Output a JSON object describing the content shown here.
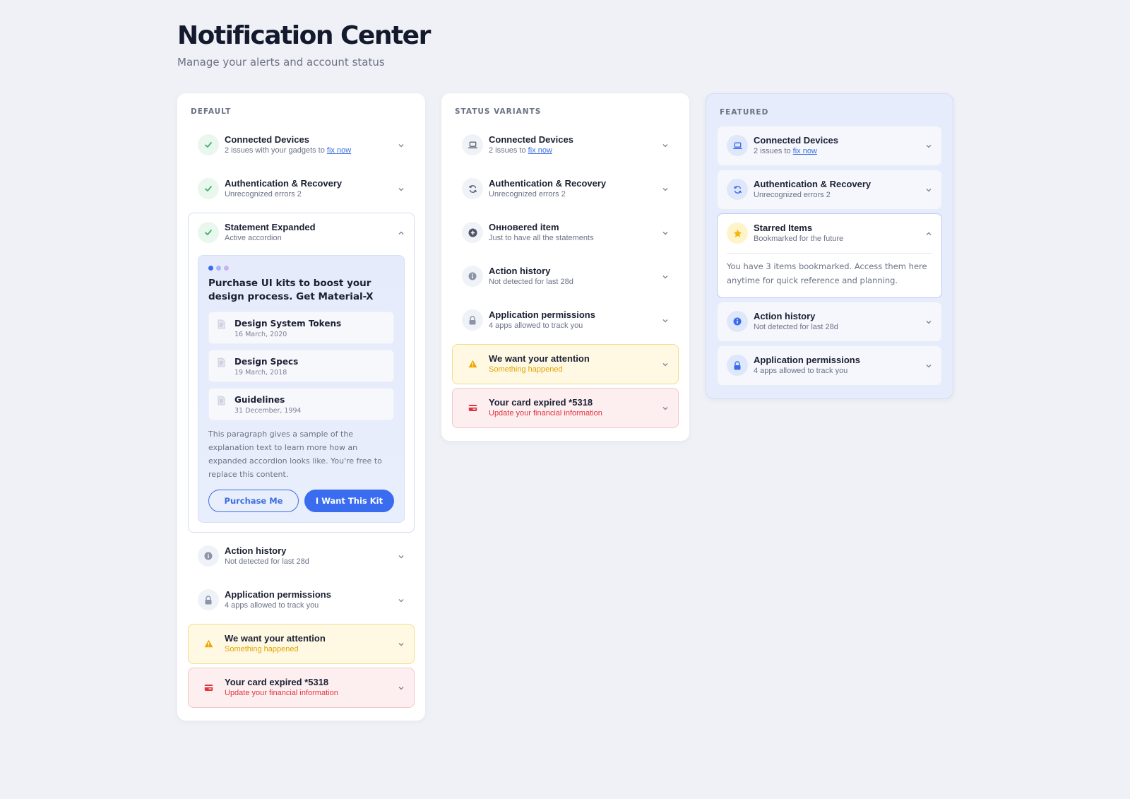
{
  "header": {
    "title": "Notification Center",
    "subtitle": "Manage your alerts and account status"
  },
  "panels": {
    "default": {
      "label": "DEFAULT",
      "items": [
        {
          "title": "Connected Devices",
          "sub_prefix": "2 issues with your gadgets to ",
          "link": "fix now",
          "icon": "check-icon"
        },
        {
          "title": "Authentication & Recovery",
          "sub": "Unrecognized errors 2",
          "icon": "check-icon"
        },
        {
          "title": "Statement Expanded",
          "sub": "Active accordion",
          "icon": "check-icon"
        },
        {
          "title": "Action history",
          "sub": "Not detected for last 28d",
          "icon": "info-icon"
        },
        {
          "title": "Application permissions",
          "sub": "4 apps allowed to track you",
          "icon": "lock-icon"
        },
        {
          "title": "We want your attention",
          "sub": "Something happened",
          "icon": "warning-icon"
        },
        {
          "title": "Your card expired *5318",
          "sub": "Update your financial information",
          "icon": "card-icon"
        }
      ],
      "expanded": {
        "promo_title": "Purchase UI kits to boost your design process. Get Material-X",
        "docs": [
          {
            "title": "Design System Tokens",
            "date": "16 March, 2020"
          },
          {
            "title": "Design Specs",
            "date": "19 March, 2018"
          },
          {
            "title": "Guidelines",
            "date": "31 December, 1994"
          }
        ],
        "paragraph": "This paragraph gives a sample of the explanation text to learn more how an expanded accordion looks like. You're free to replace this content.",
        "button_secondary": "Purchase Me",
        "button_primary": "I Want This Kit"
      }
    },
    "status": {
      "label": "STATUS VARIANTS",
      "items": [
        {
          "title": "Connected Devices",
          "sub_prefix": "2 issues to ",
          "link": "fix now",
          "icon": "laptop-icon"
        },
        {
          "title": "Authentication & Recovery",
          "sub": "Unrecognized errors 2",
          "icon": "refresh-icon"
        },
        {
          "title": "Онновered item",
          "sub": "Just to have all the statements",
          "icon": "plus-circle-icon"
        },
        {
          "title": "Action history",
          "sub": "Not detected for last 28d",
          "icon": "info-icon"
        },
        {
          "title": "Application permissions",
          "sub": "4 apps allowed to track you",
          "icon": "lock-icon"
        },
        {
          "title": "We want your attention",
          "sub": "Something happened",
          "icon": "warning-icon"
        },
        {
          "title": "Your card expired *5318",
          "sub": "Update your financial information",
          "icon": "card-icon"
        }
      ]
    },
    "featured": {
      "label": "FEATURED",
      "items": [
        {
          "title": "Connected Devices",
          "sub_prefix": "2 issues to ",
          "link": "fix now",
          "icon": "laptop-icon"
        },
        {
          "title": "Authentication & Recovery",
          "sub": "Unrecognized errors 2",
          "icon": "refresh-icon"
        },
        {
          "title": "Starred Items",
          "sub": "Bookmarked for the future",
          "icon": "star-icon"
        },
        {
          "title": "Action history",
          "sub": "Not detected for last 28d",
          "icon": "info-icon"
        },
        {
          "title": "Application permissions",
          "sub": "4 apps allowed to track you",
          "icon": "lock-icon"
        }
      ],
      "expanded_text": "You have 3 items bookmarked. Access them here anytime for quick reference and planning."
    }
  },
  "colors": {
    "accent": "#3a6cf0",
    "success": "#3fb56b",
    "warning": "#e3a300",
    "danger": "#e0343f",
    "background": "#f0f1f6"
  }
}
